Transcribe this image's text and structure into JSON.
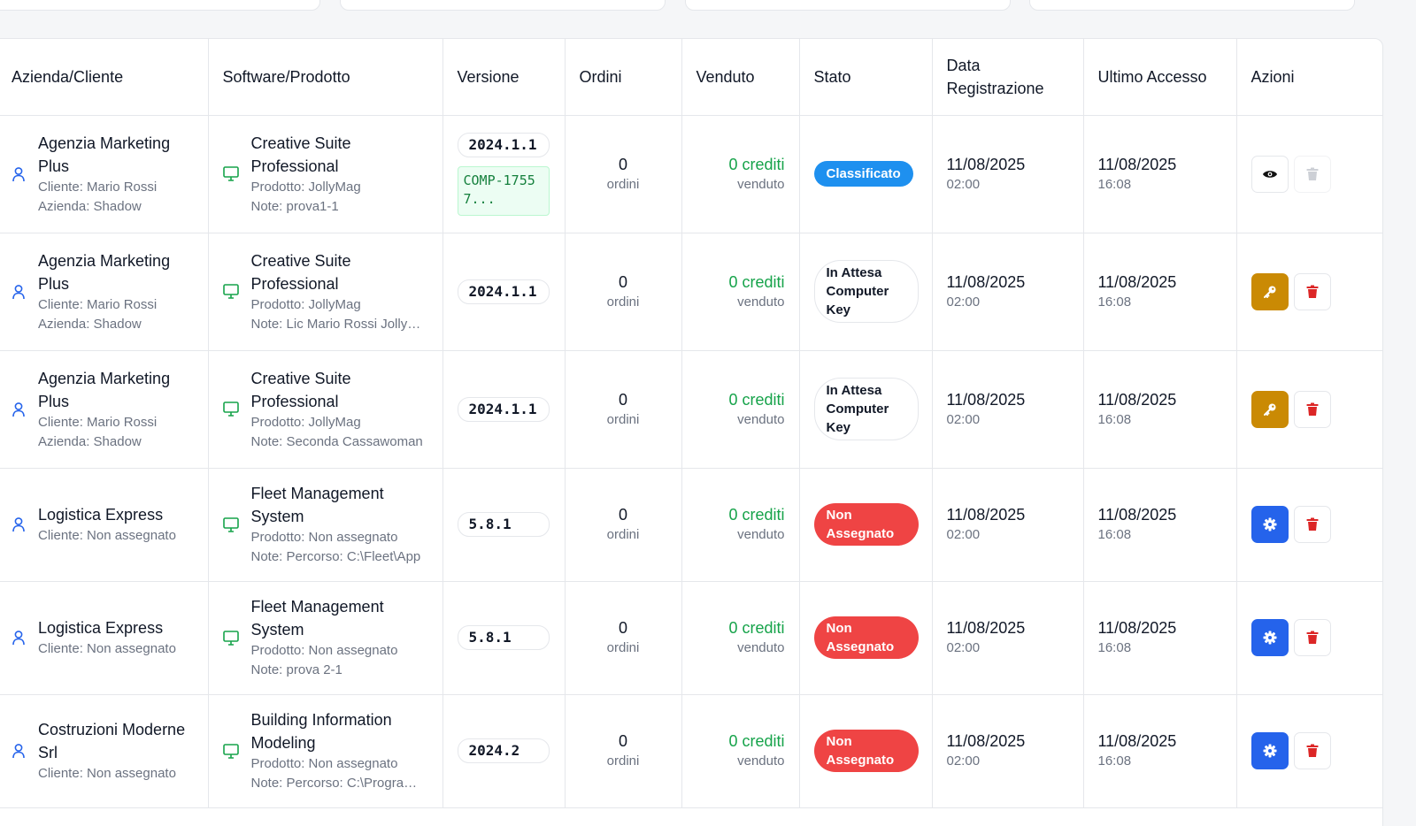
{
  "headers": {
    "client": "Azienda/Cliente",
    "software": "Software/Prodotto",
    "version": "Versione",
    "orders": "Ordini",
    "sold": "Venduto",
    "status": "Stato",
    "registered": "Data Registrazione",
    "last_access": "Ultimo Accesso",
    "actions": "Azioni"
  },
  "rows": [
    {
      "company": "Agenzia Marketing Plus",
      "client": "Cliente: Mario Rossi",
      "azienda": "Azienda: Shadow",
      "software": "Creative Suite Professional",
      "product": "Prodotto: JollyMag",
      "note": "Note: prova1-1",
      "version": "2024.1.1",
      "computer_code": "COMP-17557...",
      "orders": "0",
      "orders_label": "ordini",
      "sold": "0 crediti",
      "sold_label": "venduto",
      "status": "Classificato",
      "reg_date": "11/08/2025",
      "reg_time": "02:00",
      "last_date": "11/08/2025",
      "last_time": "16:08"
    },
    {
      "company": "Agenzia Marketing Plus",
      "client": "Cliente: Mario Rossi",
      "azienda": "Azienda: Shadow",
      "software": "Creative Suite Professional",
      "product": "Prodotto: JollyMag",
      "note": "Note: Lic Mario Rossi JollyMag",
      "version": "2024.1.1",
      "orders": "0",
      "orders_label": "ordini",
      "sold": "0 crediti",
      "sold_label": "venduto",
      "status": "In Attesa Computer Key",
      "reg_date": "11/08/2025",
      "reg_time": "02:00",
      "last_date": "11/08/2025",
      "last_time": "16:08"
    },
    {
      "company": "Agenzia Marketing Plus",
      "client": "Cliente: Mario Rossi",
      "azienda": "Azienda: Shadow",
      "software": "Creative Suite Professional",
      "product": "Prodotto: JollyMag",
      "note": "Note: Seconda Cassawoman",
      "version": "2024.1.1",
      "orders": "0",
      "orders_label": "ordini",
      "sold": "0 crediti",
      "sold_label": "venduto",
      "status": "In Attesa Computer Key",
      "reg_date": "11/08/2025",
      "reg_time": "02:00",
      "last_date": "11/08/2025",
      "last_time": "16:08"
    },
    {
      "company": "Logistica Express",
      "client": "Cliente: Non assegnato",
      "software": "Fleet Management System",
      "product": "Prodotto: Non assegnato",
      "note": "Note: Percorso: C:\\Fleet\\App",
      "version": "5.8.1",
      "orders": "0",
      "orders_label": "ordini",
      "sold": "0 crediti",
      "sold_label": "venduto",
      "status": "Non Assegnato",
      "reg_date": "11/08/2025",
      "reg_time": "02:00",
      "last_date": "11/08/2025",
      "last_time": "16:08"
    },
    {
      "company": "Logistica Express",
      "client": "Cliente: Non assegnato",
      "software": "Fleet Management System",
      "product": "Prodotto: Non assegnato",
      "note": "Note: prova 2-1",
      "version": "5.8.1",
      "orders": "0",
      "orders_label": "ordini",
      "sold": "0 crediti",
      "sold_label": "venduto",
      "status": "Non Assegnato",
      "reg_date": "11/08/2025",
      "reg_time": "02:00",
      "last_date": "11/08/2025",
      "last_time": "16:08"
    },
    {
      "company": "Costruzioni Moderne Srl",
      "client": "Cliente: Non assegnato",
      "software": "Building Information Modeling",
      "product": "Prodotto: Non assegnato",
      "note": "Note: Percorso: C:\\Programmi\\BIM",
      "version": "2024.2",
      "orders": "0",
      "orders_label": "ordini",
      "sold": "0 crediti",
      "sold_label": "venduto",
      "status": "Non Assegnato",
      "reg_date": "11/08/2025",
      "reg_time": "02:00",
      "last_date": "11/08/2025",
      "last_time": "16:08"
    }
  ],
  "colors": {
    "accent_blue": "#2563eb",
    "status_blue": "#1e90ef",
    "status_red": "#ef4444",
    "key_amber": "#ca8a04",
    "delete_red": "#dc2626",
    "credit_green": "#16a34a"
  },
  "icons": {
    "client": "user-icon",
    "software": "monitor-icon",
    "view": "eye-icon",
    "key": "key-icon",
    "settings": "gear-icon",
    "delete": "trash-icon"
  }
}
